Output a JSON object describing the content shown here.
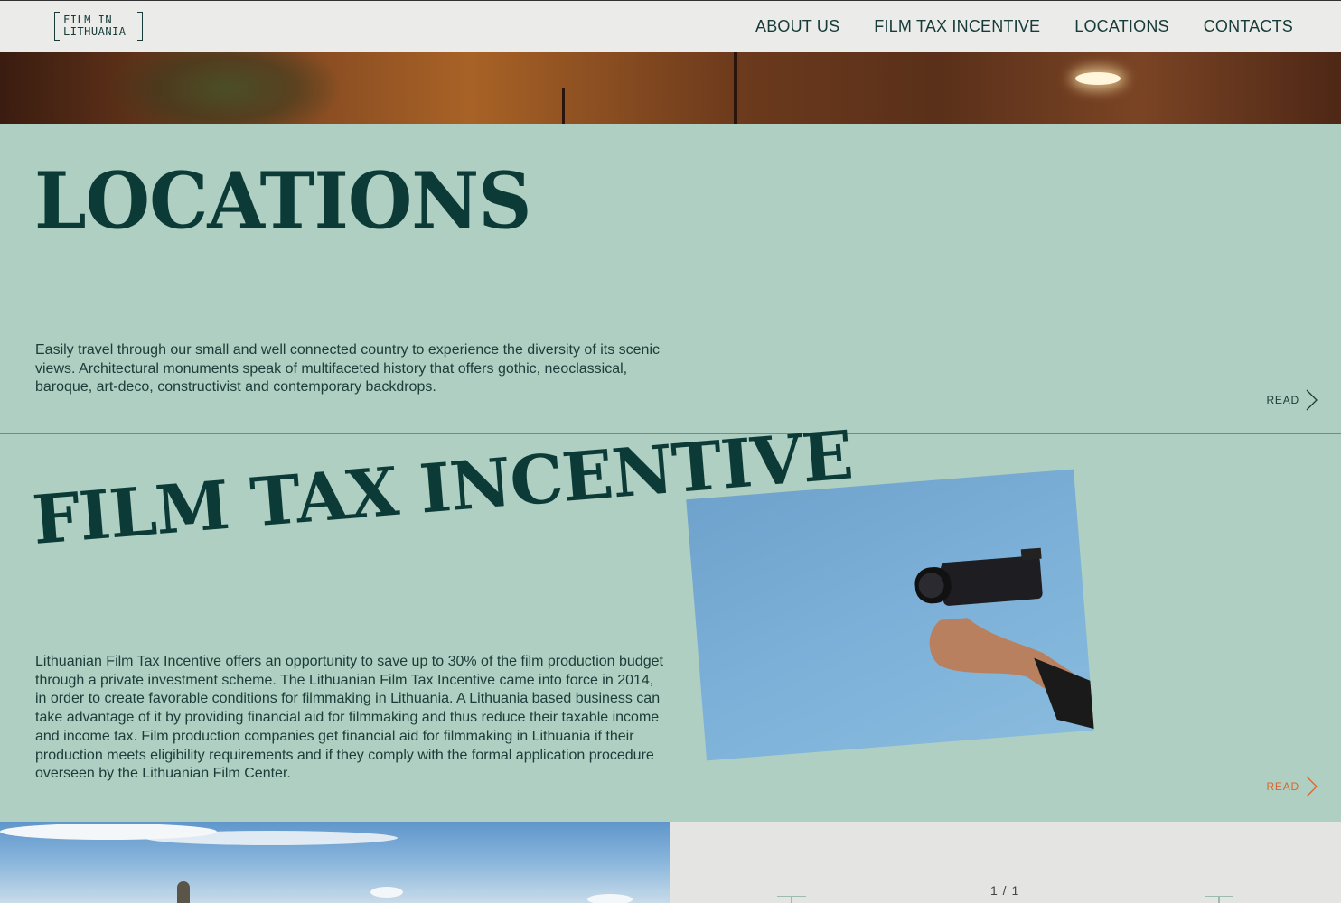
{
  "logo": {
    "line1": "FILM IN",
    "line2": "LITHUANIA"
  },
  "nav": [
    {
      "label": "ABOUT US"
    },
    {
      "label": "FILM TAX INCENTIVE"
    },
    {
      "label": "LOCATIONS"
    },
    {
      "label": "CONTACTS"
    }
  ],
  "locations": {
    "title": "LOCATIONS",
    "text": "Easily travel through our small and well connected country to experience the diversity of its scenic views. Architectural monuments speak of multifaceted history that offers gothic, neoclassical, baroque, art-deco, constructivist and contemporary backdrops.",
    "read_label": "READ"
  },
  "tax_incentive": {
    "title": "FILM TAX INCENTIVE",
    "text": "Lithuanian Film Tax Incentive offers an opportunity to save up to 30% of the film production budget through a private investment scheme. The Lithuanian Film Tax Incentive came into force in 2014, in order to create favorable conditions for filmmaking in Lithuania. A Lithuania based business can take advantage of it by providing financial aid for filmmaking and thus reduce their taxable income and income tax. Film production companies get financial aid for filmmaking in Lithuania if their production meets eligibility requirements and if they comply with the formal application procedure overseen by the Lithuanian Film Center.",
    "read_label": "READ",
    "read_color": "#d9672c"
  },
  "slider": {
    "pager": "1 / 1"
  },
  "colors": {
    "section_bg": "#aecfc1",
    "title": "#0c3b37",
    "header_bg": "#ebebe9"
  }
}
